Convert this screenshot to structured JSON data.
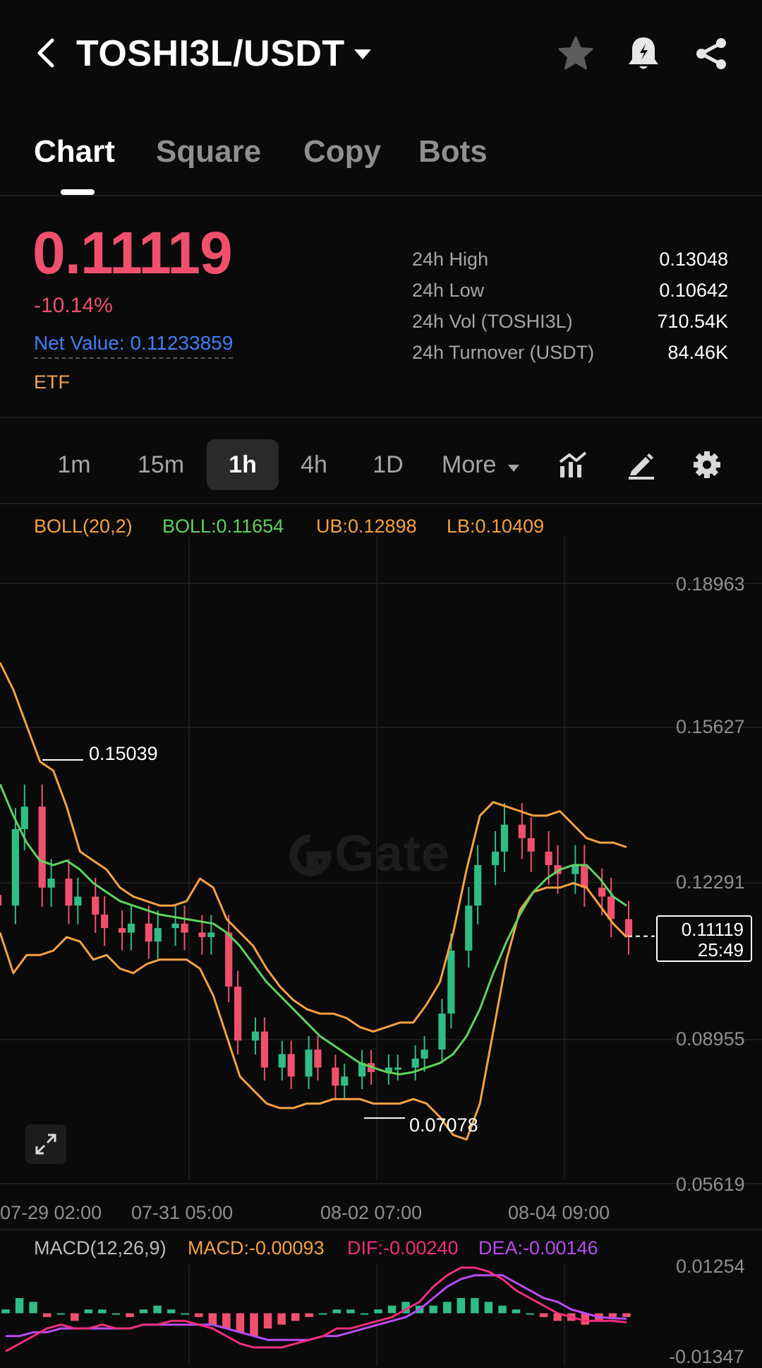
{
  "header": {
    "pair": "TOSHI3L/USDT",
    "icons": [
      "back-arrow-icon",
      "dropdown-caret-icon",
      "star-icon",
      "bell-alert-icon",
      "share-icon"
    ]
  },
  "tabs": [
    {
      "label": "Chart",
      "active": true
    },
    {
      "label": "Square",
      "active": false
    },
    {
      "label": "Copy",
      "active": false
    },
    {
      "label": "Bots",
      "active": false
    }
  ],
  "price": {
    "last": "0.11119",
    "change": "-10.14%",
    "net_value": "Net Value: 0.11233859",
    "tag": "ETF"
  },
  "stats": [
    {
      "label": "24h High",
      "value": "0.13048"
    },
    {
      "label": "24h Low",
      "value": "0.10642"
    },
    {
      "label": "24h Vol (TOSHI3L)",
      "value": "710.54K"
    },
    {
      "label": "24h Turnover (USDT)",
      "value": "84.46K"
    }
  ],
  "intervals": [
    {
      "label": "1m",
      "active": false
    },
    {
      "label": "15m",
      "active": false
    },
    {
      "label": "1h",
      "active": true
    },
    {
      "label": "4h",
      "active": false
    },
    {
      "label": "1D",
      "active": false
    },
    {
      "label": "More",
      "active": false
    }
  ],
  "toolbar_icons": [
    "indicator-chart-icon",
    "draw-pen-icon",
    "settings-gear-icon"
  ],
  "boll_legend": {
    "name": "BOLL(20,2)",
    "mid": "BOLL:0.11654",
    "ub": "UB:0.12898",
    "lb": "LB:0.10409"
  },
  "price_axis": [
    "0.18963",
    "0.15627",
    "0.12291",
    "0.08955",
    "0.05619"
  ],
  "time_axis": [
    "07-29 02:00",
    "07-31 05:00",
    "08-02 07:00",
    "08-04 09:00"
  ],
  "markers": {
    "high": "0.15039",
    "low": "0.07078",
    "current_price": "0.11119",
    "countdown": "25:49"
  },
  "watermark": "Gate",
  "macd_legend": {
    "name": "MACD(12,26,9)",
    "macd": "MACD:-0.00093",
    "dif": "DIF:-0.00240",
    "dea": "DEA:-0.00146"
  },
  "macd_axis": [
    "0.01254",
    "-0.01347"
  ],
  "colors": {
    "down": "#f0506e",
    "up": "#2ebd85",
    "boll_mid": "#5fd35f",
    "boll_band": "#f5a142",
    "dif": "#f02e7d",
    "dea": "#b84cf0",
    "link": "#3f7ef5"
  },
  "chart_data": {
    "type": "candlestick",
    "interval": "1h",
    "y_range": [
      0.05619,
      0.18963
    ],
    "x_ticks": [
      "07-29 02:00",
      "07-31 05:00",
      "08-02 07:00",
      "08-04 09:00"
    ],
    "high_marker": 0.15039,
    "low_marker": 0.07078,
    "last_price": 0.11119,
    "boll_mid": [
      0.145,
      0.138,
      0.132,
      0.128,
      0.127,
      0.128,
      0.126,
      0.123,
      0.121,
      0.119,
      0.118,
      0.117,
      0.116,
      0.1155,
      0.115,
      0.1145,
      0.114,
      0.112,
      0.109,
      0.105,
      0.101,
      0.098,
      0.095,
      0.092,
      0.089,
      0.087,
      0.085,
      0.083,
      0.082,
      0.081,
      0.0805,
      0.081,
      0.082,
      0.083,
      0.085,
      0.089,
      0.095,
      0.103,
      0.11,
      0.116,
      0.121,
      0.124,
      0.126,
      0.127,
      0.127,
      0.124,
      0.12,
      0.118
    ],
    "boll_ub": [
      0.172,
      0.166,
      0.158,
      0.15,
      0.148,
      0.14,
      0.13,
      0.128,
      0.126,
      0.122,
      0.12,
      0.119,
      0.118,
      0.118,
      0.119,
      0.124,
      0.122,
      0.115,
      0.112,
      0.109,
      0.104,
      0.1,
      0.097,
      0.095,
      0.094,
      0.094,
      0.093,
      0.091,
      0.09,
      0.091,
      0.092,
      0.092,
      0.096,
      0.101,
      0.112,
      0.126,
      0.138,
      0.141,
      0.14,
      0.139,
      0.138,
      0.138,
      0.139,
      0.136,
      0.133,
      0.132,
      0.132,
      0.131
    ],
    "boll_lb": [
      0.112,
      0.103,
      0.107,
      0.107,
      0.108,
      0.111,
      0.11,
      0.106,
      0.107,
      0.104,
      0.103,
      0.105,
      0.106,
      0.106,
      0.106,
      0.104,
      0.098,
      0.089,
      0.08,
      0.077,
      0.074,
      0.073,
      0.073,
      0.074,
      0.074,
      0.075,
      0.075,
      0.075,
      0.074,
      0.074,
      0.074,
      0.075,
      0.074,
      0.071,
      0.067,
      0.066,
      0.074,
      0.09,
      0.106,
      0.117,
      0.121,
      0.122,
      0.122,
      0.123,
      0.122,
      0.118,
      0.114,
      0.111
    ],
    "candles_close": [
      0.118,
      0.135,
      0.14,
      0.122,
      0.124,
      0.118,
      0.12,
      0.116,
      0.113,
      0.112,
      0.114,
      0.11,
      0.113,
      0.114,
      0.112,
      0.111,
      0.112,
      0.1,
      0.088,
      0.09,
      0.082,
      0.085,
      0.08,
      0.086,
      0.082,
      0.078,
      0.08,
      0.083,
      0.081,
      0.082,
      0.082,
      0.084,
      0.086,
      0.094,
      0.108,
      0.118,
      0.127,
      0.13,
      0.136,
      0.133,
      0.13,
      0.127,
      0.125,
      0.127,
      0.122,
      0.12,
      0.115,
      0.111
    ],
    "macd_range": [
      -0.01347,
      0.01254
    ],
    "macd_hist": [
      0.001,
      0.004,
      0.003,
      -0.001,
      0.0,
      -0.002,
      0.001,
      0.001,
      0.0,
      -0.001,
      0.001,
      0.002,
      0.001,
      0.0,
      -0.001,
      -0.003,
      -0.004,
      -0.005,
      -0.006,
      -0.004,
      -0.003,
      -0.002,
      -0.001,
      0.0,
      0.001,
      0.001,
      0.0,
      0.001,
      0.002,
      0.003,
      0.002,
      0.002,
      0.003,
      0.004,
      0.004,
      0.003,
      0.002,
      0.001,
      0.0,
      -0.001,
      -0.002,
      -0.002,
      -0.003,
      -0.002,
      -0.001,
      -0.001
    ],
    "dif": [
      -0.01,
      -0.008,
      -0.006,
      -0.004,
      -0.003,
      -0.004,
      -0.004,
      -0.003,
      -0.004,
      -0.004,
      -0.003,
      -0.003,
      -0.002,
      -0.002,
      -0.003,
      -0.004,
      -0.006,
      -0.008,
      -0.009,
      -0.009,
      -0.009,
      -0.008,
      -0.007,
      -0.006,
      -0.004,
      -0.004,
      -0.003,
      -0.002,
      -0.001,
      0.001,
      0.003,
      0.007,
      0.01,
      0.012,
      0.012,
      0.011,
      0.009,
      0.006,
      0.004,
      0.002,
      0.0,
      -0.001,
      -0.002,
      -0.002,
      -0.002,
      -0.0024
    ],
    "dea": [
      -0.006,
      -0.006,
      -0.005,
      -0.005,
      -0.004,
      -0.004,
      -0.004,
      -0.004,
      -0.004,
      -0.004,
      -0.003,
      -0.003,
      -0.003,
      -0.003,
      -0.003,
      -0.003,
      -0.004,
      -0.005,
      -0.006,
      -0.007,
      -0.007,
      -0.007,
      -0.007,
      -0.006,
      -0.006,
      -0.005,
      -0.004,
      -0.003,
      -0.002,
      -0.001,
      0.001,
      0.004,
      0.007,
      0.009,
      0.01,
      0.01,
      0.01,
      0.008,
      0.006,
      0.004,
      0.003,
      0.001,
      0.0,
      -0.001,
      -0.0013,
      -0.00146
    ]
  }
}
